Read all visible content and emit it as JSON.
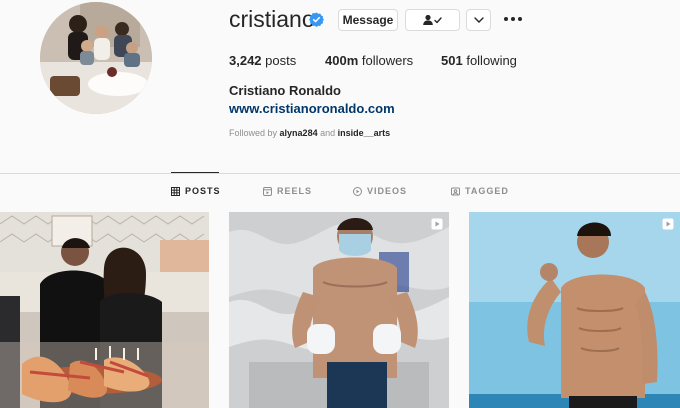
{
  "profile": {
    "username": "cristiano",
    "verified": true,
    "message_label": "Message",
    "posts_count": "3,242",
    "posts_label": "posts",
    "followers_count": "400m",
    "followers_label": "followers",
    "following_count": "501",
    "following_label": "following",
    "full_name": "Cristiano Ronaldo",
    "website": "www.cristianoronaldo.com",
    "followed_by_prefix": "Followed by",
    "followed_by_user1": "alyna284",
    "followed_by_and": "and",
    "followed_by_user2": "inside__arts"
  },
  "tabs": [
    {
      "label": "POSTS",
      "icon": "grid-icon",
      "active": true
    },
    {
      "label": "REELS",
      "icon": "reels-icon",
      "active": false
    },
    {
      "label": "VIDEOS",
      "icon": "play-circle-icon",
      "active": false
    },
    {
      "label": "TAGGED",
      "icon": "tag-icon",
      "active": false
    }
  ],
  "colors": {
    "accent_blue": "#3897f0",
    "link": "#00376b",
    "muted": "#8e8e8e",
    "border": "#dbdbdb"
  }
}
